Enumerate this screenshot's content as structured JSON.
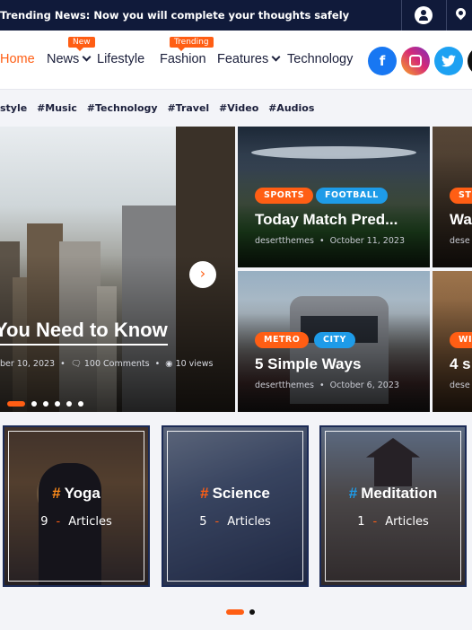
{
  "topbar": {
    "ticker_label": "Trending News:",
    "ticker_text": "Now you will complete your thoughts safely",
    "user_icon": "user-icon",
    "location_icon": "map-pin-icon"
  },
  "nav": {
    "items": [
      {
        "label": "Home",
        "active": true
      },
      {
        "label": "News",
        "badge": "New",
        "dropdown": true
      },
      {
        "label": "Lifestyle"
      },
      {
        "label": "Fashion",
        "badge": "Trending"
      },
      {
        "label": "Features",
        "dropdown": true
      },
      {
        "label": "Technology"
      }
    ],
    "social": [
      {
        "name": "facebook-icon",
        "glyph": "f",
        "color": "#1877f2"
      },
      {
        "name": "instagram-icon",
        "glyph": "◎",
        "color": "#d62976"
      },
      {
        "name": "twitter-icon",
        "glyph": "t",
        "color": "#1da1f2"
      }
    ]
  },
  "tags": [
    "style",
    "#Music",
    "#Technology",
    "#Travel",
    "#Video",
    "#Audios"
  ],
  "hero": {
    "title": "You Need to Know",
    "date": "ber 10, 2023",
    "comments": "100 Comments",
    "views": "10 views",
    "next_icon": "chevron-right-icon",
    "slides": 6,
    "active_slide": 1
  },
  "cards": [
    {
      "chips": [
        "SPORTS",
        "FOOTBALL"
      ],
      "title": "Today Match Pred...",
      "author": "desertthemes",
      "date": "October 11, 2023"
    },
    {
      "chips": [
        "ST"
      ],
      "title": "Wa",
      "author": "dese",
      "date": ""
    },
    {
      "chips": [
        "METRO",
        "CITY"
      ],
      "title": "5 Simple Ways",
      "author": "desertthemes",
      "date": "October 6, 2023"
    },
    {
      "chips": [
        "WI"
      ],
      "title": "4 s",
      "author": "dese",
      "date": ""
    }
  ],
  "categories": [
    {
      "name": "Yoga",
      "count": "9",
      "unit": "Articles",
      "hash_color": "#ff8c1a"
    },
    {
      "name": "Science",
      "count": "5",
      "unit": "Articles",
      "hash_color": "#ff5e14"
    },
    {
      "name": "Meditation",
      "count": "1",
      "unit": "Articles",
      "hash_color": "#1e9be8"
    }
  ],
  "colors": {
    "accent": "#ff5e14",
    "blue": "#1e9be8",
    "navy": "#101a3a"
  }
}
